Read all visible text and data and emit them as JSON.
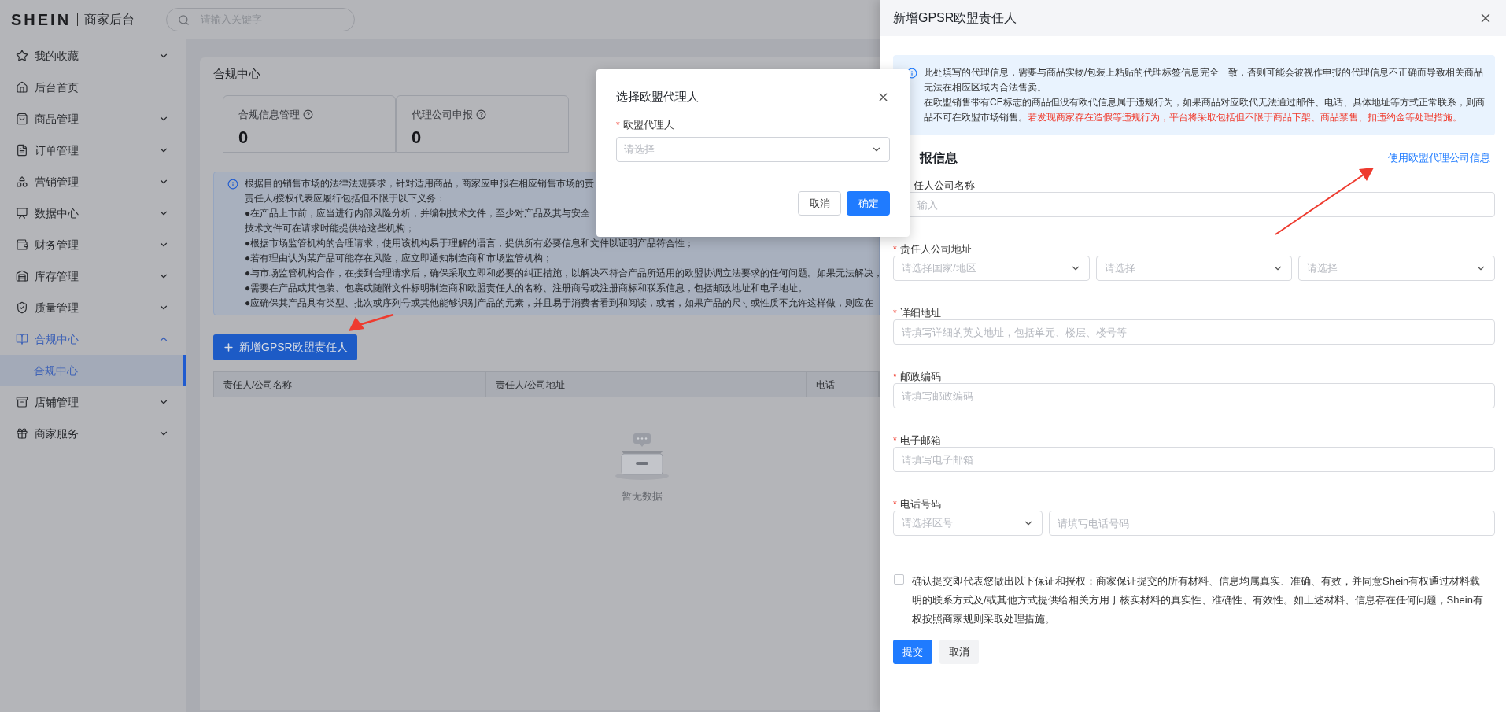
{
  "header": {
    "logo": "SHEIN",
    "subtitle": "商家后台",
    "search": {
      "placeholder": "请输入关键字"
    }
  },
  "sidebar": {
    "items": [
      {
        "kind": "group",
        "label": "我的收藏",
        "expanded": false
      },
      {
        "kind": "link",
        "label": "后台首页",
        "selected": false
      },
      {
        "kind": "group",
        "label": "商品管理",
        "expanded": false
      },
      {
        "kind": "group",
        "label": "订单管理",
        "expanded": false
      },
      {
        "kind": "group",
        "label": "营销管理",
        "expanded": false
      },
      {
        "kind": "group",
        "label": "数据中心",
        "expanded": false
      },
      {
        "kind": "group",
        "label": "财务管理",
        "expanded": false
      },
      {
        "kind": "group",
        "label": "库存管理",
        "expanded": false
      },
      {
        "kind": "group",
        "label": "质量管理",
        "expanded": false
      },
      {
        "kind": "group",
        "label": "合规中心",
        "expanded": true,
        "children": [
          {
            "kind": "link",
            "label": "合规中心",
            "selected": true
          }
        ]
      },
      {
        "kind": "group",
        "label": "店铺管理",
        "expanded": false
      },
      {
        "kind": "group",
        "label": "商家服务",
        "expanded": false
      }
    ]
  },
  "page": {
    "title": "合规中心",
    "stats": [
      {
        "label": "合规信息管理",
        "value": "0"
      },
      {
        "label": "代理公司申报",
        "value": "0"
      }
    ],
    "notice": [
      "根据目的销售市场的法律法规要求，针对适用商品，商家应申报在相应销售市场的责",
      "责任人/授权代表应履行包括但不限于以下义务：",
      "●在产品上市前，应当进行内部风险分析，并编制技术文件，至少对产品及其与安全",
      "技术文件可在请求时能提供给这些机构；",
      "●根据市场监管机构的合理请求，使用该机构易于理解的语言，提供所有必要信息和文件以证明产品符合性；",
      "●若有理由认为某产品可能存在风险，应立即通知制造商和市场监管机构；",
      "●与市场监管机构合作，在接到合理请求后，确保采取立即和必要的纠正措施，以解决不符合产品所适用的欧盟协调立法要求的任何问题。如果无法解决，",
      "●需要在产品或其包装、包裹或随附文件标明制造商和欧盟责任人的名称、注册商号或注册商标和联系信息，包括邮政地址和电子地址。",
      "●应确保其产品具有类型、批次或序列号或其他能够识别产品的元素，并且易于消费者看到和阅读，或者，如果产品的尺寸或性质不允许这样做，则应在"
    ],
    "add_button": "新增GPSR欧盟责任人",
    "table": {
      "columns": [
        "责任人/公司名称",
        "责任人/公司地址",
        "电话"
      ],
      "empty_text": "暂无数据"
    }
  },
  "modal": {
    "title": "选择欧盟代理人",
    "field": {
      "label": "欧盟代理人",
      "required_mark": "*",
      "placeholder": "请选择"
    },
    "buttons": [
      {
        "label": "取消",
        "kind": "secondary"
      },
      {
        "label": "确定",
        "kind": "primary"
      }
    ]
  },
  "drawer": {
    "title": "新增GPSR欧盟责任人",
    "notice": {
      "paragraphs": [
        "此处填写的代理信息，需要与商品实物/包装上粘贴的代理标签信息完全一致，否则可能会被视作申报的代理信息不正确而导致相关商品无法在相应区域内合法售卖。",
        "在欧盟销售带有CE标志的商品但没有欧代信息属于违规行为，如果商品对应欧代无法通过邮件、电话、具体地址等方式正常联系，则商品不可在欧盟市场销售。"
      ],
      "warning": "若发现商家存在造假等违规行为，平台将采取包括但不限于商品下架、商品禁售、扣违约金等处理措施。"
    },
    "section_title": "报信息",
    "section_link": "使用欧盟代理公司信息",
    "fields": [
      {
        "label": "任人公司名称",
        "controls": [
          {
            "kind": "input",
            "placeholder": "输入"
          }
        ]
      },
      {
        "label": "责任人公司地址",
        "required_mark": "*",
        "controls": [
          {
            "kind": "select",
            "placeholder": "请选择国家/地区"
          },
          {
            "kind": "select",
            "placeholder": "请选择"
          },
          {
            "kind": "select",
            "placeholder": "请选择"
          }
        ]
      },
      {
        "label": "详细地址",
        "required_mark": "*",
        "controls": [
          {
            "kind": "input",
            "placeholder": "请填写详细的英文地址，包括单元、楼层、楼号等"
          }
        ]
      },
      {
        "label": "邮政编码",
        "required_mark": "*",
        "controls": [
          {
            "kind": "input",
            "placeholder": "请填写邮政编码"
          }
        ]
      },
      {
        "label": "电子邮箱",
        "required_mark": "*",
        "controls": [
          {
            "kind": "input",
            "placeholder": "请填写电子邮箱"
          }
        ]
      },
      {
        "label": "电话号码",
        "required_mark": "*",
        "controls": [
          {
            "kind": "select",
            "placeholder": "请选择区号"
          },
          {
            "kind": "input",
            "placeholder": "请填写电话号码"
          }
        ]
      }
    ],
    "agreement": {
      "checked": false,
      "text": "确认提交即代表您做出以下保证和授权：商家保证提交的所有材料、信息均属真实、准确、有效，并同意Shein有权通过材料载明的联系方式及/或其他方式提供给相关方用于核实材料的真实性、准确性、有效性。如上述材料、信息存在任何问题，Shein有权按照商家规则采取处理措施。"
    },
    "buttons": [
      {
        "label": "提交",
        "kind": "primary"
      },
      {
        "label": "取消",
        "kind": "secondary"
      }
    ]
  }
}
